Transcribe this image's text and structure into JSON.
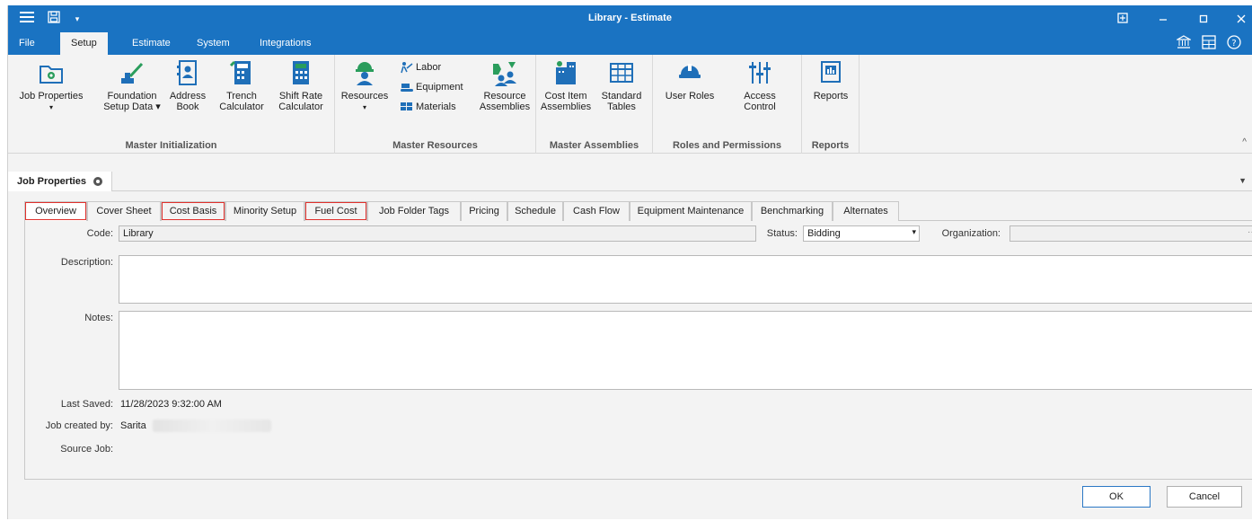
{
  "window": {
    "title": "Library - Estimate"
  },
  "menu": {
    "tabs": [
      "File",
      "Setup",
      "Estimate",
      "System",
      "Integrations"
    ],
    "active": "Setup"
  },
  "ribbon": {
    "groups": {
      "master_initialization": "Master Initialization",
      "master_resources": "Master Resources",
      "master_assemblies": "Master Assemblies",
      "roles_permissions": "Roles and Permissions",
      "reports": "Reports"
    },
    "buttons": {
      "job_properties": "Job Properties",
      "foundation_1": "Foundation",
      "foundation_2": "Setup Data ▾",
      "address_1": "Address",
      "address_2": "Book",
      "trench_1": "Trench",
      "trench_2": "Calculator",
      "shift_1": "Shift Rate",
      "shift_2": "Calculator",
      "resources": "Resources",
      "labor": "Labor",
      "equipment": "Equipment",
      "materials": "Materials",
      "res_asm_1": "Resource",
      "res_asm_2": "Assemblies",
      "cost_item_1": "Cost Item",
      "cost_item_2": "Assemblies",
      "std_tables_1": "Standard",
      "std_tables_2": "Tables",
      "user_roles": "User Roles",
      "access_1": "Access",
      "access_2": "Control",
      "reports": "Reports"
    }
  },
  "doc_tab": {
    "label": "Job Properties"
  },
  "page_tabs": [
    "Overview",
    "Cover Sheet",
    "Cost Basis",
    "Minority Setup",
    "Fuel Cost",
    "Job Folder Tags",
    "Pricing",
    "Schedule",
    "Cash Flow",
    "Equipment Maintenance",
    "Benchmarking",
    "Alternates"
  ],
  "form": {
    "code_label": "Code:",
    "code_value": "Library",
    "status_label": "Status:",
    "status_value": "Bidding",
    "organization_label": "Organization:",
    "organization_value": "",
    "organization_more": "···",
    "description_label": "Description:",
    "description_value": "",
    "notes_label": "Notes:",
    "notes_value": "",
    "last_saved_label": "Last Saved:",
    "last_saved_value": "11/28/2023 9:32:00 AM",
    "created_by_label": "Job created by:",
    "created_by_value": "Sarita",
    "source_job_label": "Source Job:",
    "source_job_value": ""
  },
  "buttons": {
    "ok": "OK",
    "cancel": "Cancel"
  }
}
